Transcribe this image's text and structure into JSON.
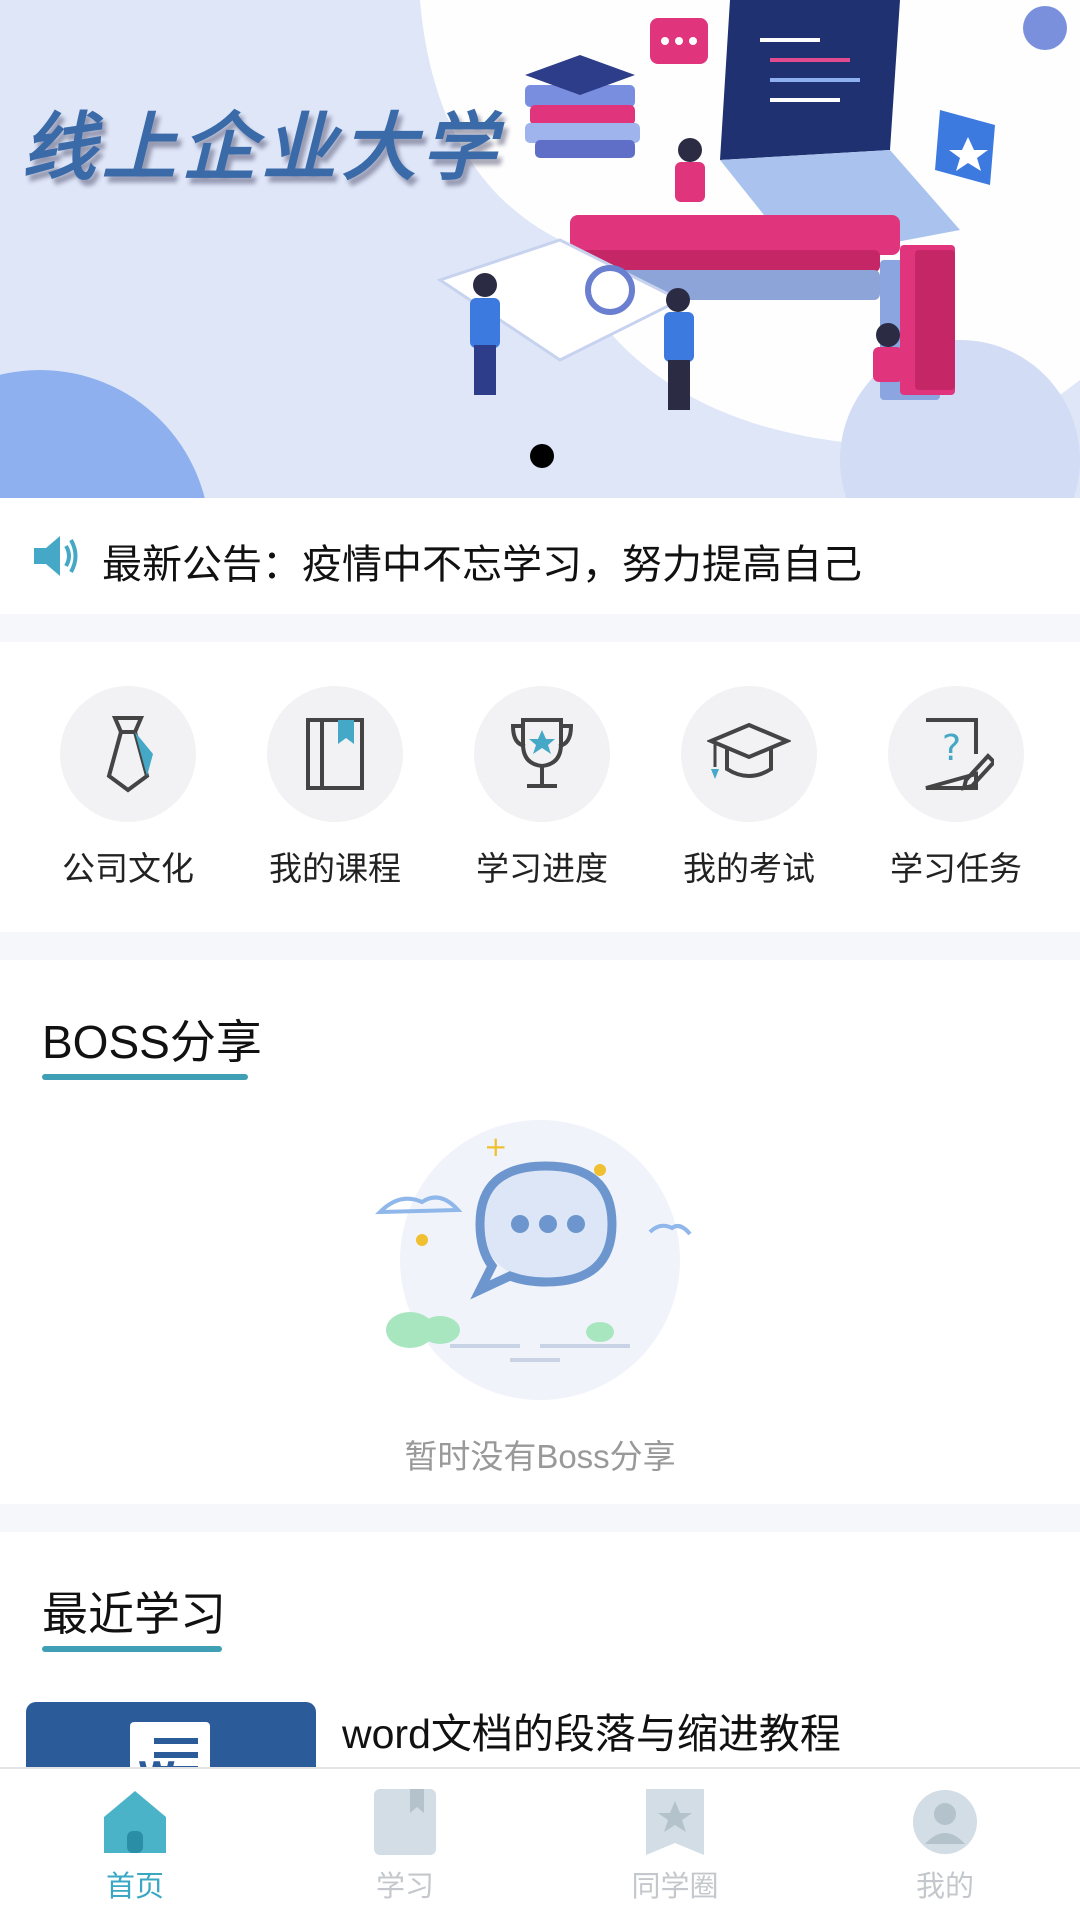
{
  "banner": {
    "title": "线上企业大学"
  },
  "notice": {
    "text": "最新公告：疫情中不忘学习，努力提高自己",
    "icon": "speaker-icon"
  },
  "menu": [
    {
      "label": "公司文化",
      "icon": "tie-icon"
    },
    {
      "label": "我的课程",
      "icon": "book-icon"
    },
    {
      "label": "学习进度",
      "icon": "trophy-icon"
    },
    {
      "label": "我的考试",
      "icon": "graduation-cap-icon"
    },
    {
      "label": "学习任务",
      "icon": "task-edit-icon"
    }
  ],
  "boss_share": {
    "title": "BOSS分享",
    "empty_text": "暂时没有Boss分享"
  },
  "recent": {
    "title": "最近学习",
    "items": [
      {
        "title": "word文档的段落与缩进教程"
      }
    ]
  },
  "tabbar": [
    {
      "label": "首页",
      "icon": "home-icon",
      "active": true
    },
    {
      "label": "学习",
      "icon": "bookmark-icon",
      "active": false
    },
    {
      "label": "同学圈",
      "icon": "star-bookmark-icon",
      "active": false
    },
    {
      "label": "我的",
      "icon": "user-icon",
      "active": false
    }
  ],
  "colors": {
    "accent": "#3f9fb5",
    "tab_active": "#3aa8c4",
    "tab_inactive": "#c4c8cc",
    "banner_bg": "#dfe6f8"
  }
}
